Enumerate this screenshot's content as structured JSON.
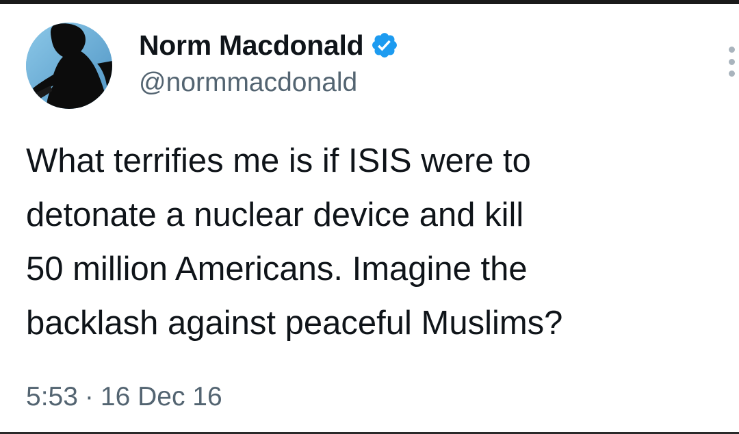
{
  "tweet": {
    "author": {
      "display_name": "Norm Macdonald",
      "handle": "@normmacdonald",
      "verified": true
    },
    "text_lines": [
      "What terrifies me is if ISIS were to",
      "detonate a nuclear device and kill",
      "50 million Americans. Imagine the",
      "backlash against peaceful Muslims?"
    ],
    "time": "5:53",
    "separator": "·",
    "date": "16 Dec 16"
  },
  "icons": {
    "verified": "verified-badge-icon",
    "more": "more-options-icon"
  },
  "colors": {
    "text": "#0f1419",
    "secondary_text": "#536471",
    "verified_blue": "#1d9bf0",
    "background": "#ffffff"
  }
}
